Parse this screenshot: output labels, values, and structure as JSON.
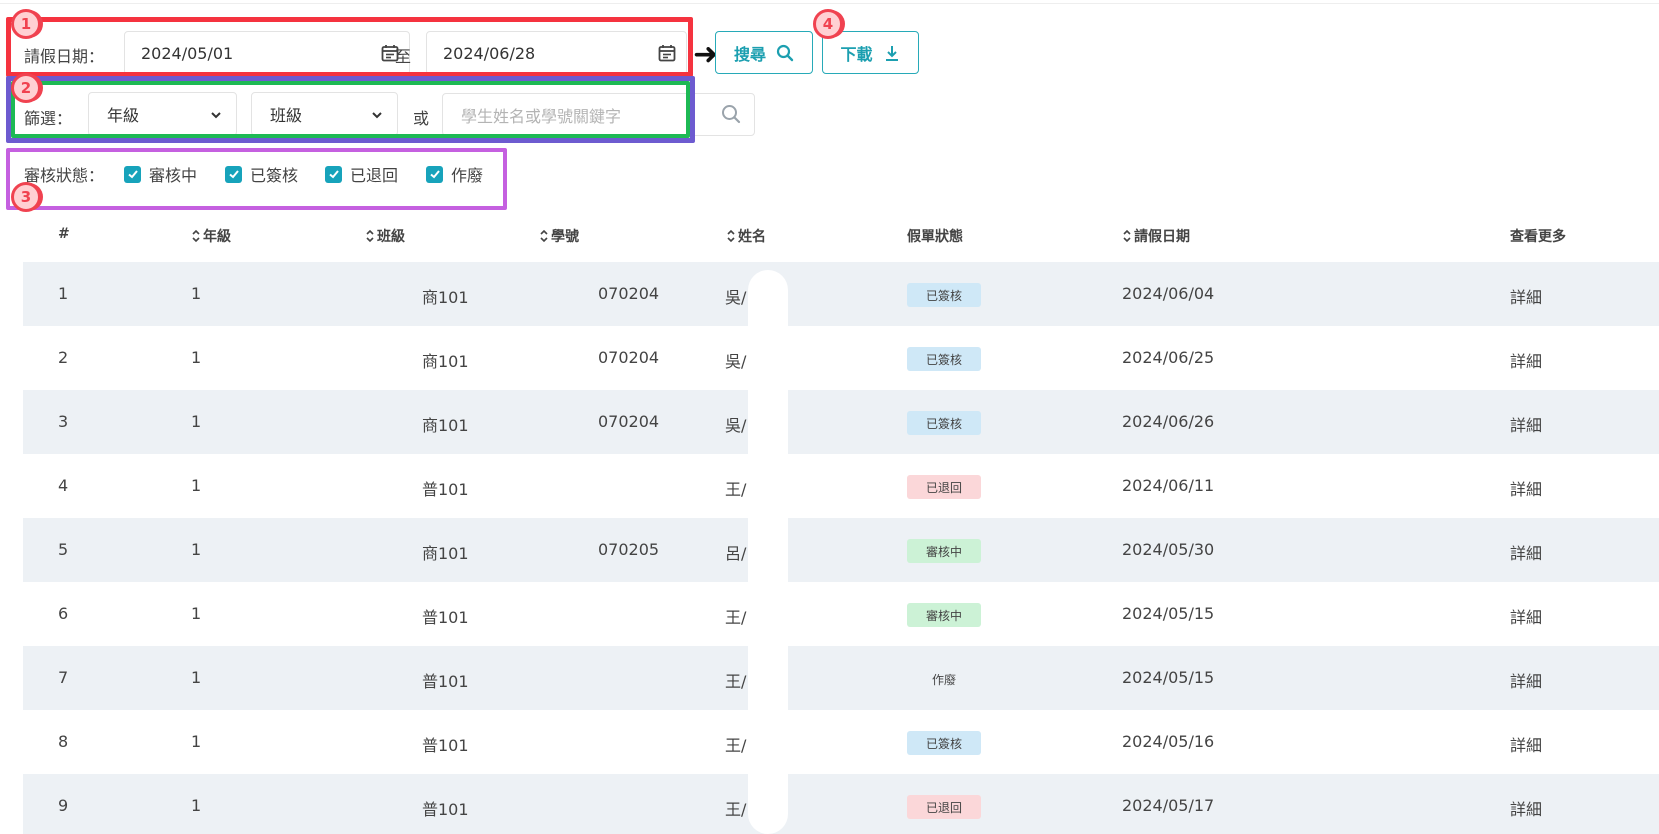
{
  "filters": {
    "date_label": "請假日期：",
    "date_from": "2024/05/01",
    "date_sep": "至",
    "date_to": "2024/06/28",
    "search_label": "搜尋",
    "download_label": "下載",
    "filter_label": "篩選：",
    "grade_select": "年級",
    "class_select": "班級",
    "or_label": "或",
    "keyword_placeholder": "學生姓名或學號關鍵字",
    "status_label": "審核狀態：",
    "status_options": [
      "審核中",
      "已簽核",
      "已退回",
      "作廢"
    ]
  },
  "annotations": [
    "1",
    "2",
    "3",
    "4"
  ],
  "table": {
    "headers": [
      "#",
      "年級",
      "班級",
      "學號",
      "姓名",
      "假單狀態",
      "請假日期",
      "查看更多"
    ],
    "rows": [
      {
        "no": "1",
        "grade": "1",
        "class": "商101",
        "id": "070204",
        "name": "吳/",
        "status": "已簽核",
        "date": "2024/06/04",
        "more": "詳細"
      },
      {
        "no": "2",
        "grade": "1",
        "class": "商101",
        "id": "070204",
        "name": "吳/",
        "status": "已簽核",
        "date": "2024/06/25",
        "more": "詳細"
      },
      {
        "no": "3",
        "grade": "1",
        "class": "商101",
        "id": "070204",
        "name": "吳/",
        "status": "已簽核",
        "date": "2024/06/26",
        "more": "詳細"
      },
      {
        "no": "4",
        "grade": "1",
        "class": "普101",
        "id": "",
        "name": "王/",
        "status": "已退回",
        "date": "2024/06/11",
        "more": "詳細"
      },
      {
        "no": "5",
        "grade": "1",
        "class": "商101",
        "id": "070205",
        "name": "呂/",
        "status": "審核中",
        "date": "2024/05/30",
        "more": "詳細"
      },
      {
        "no": "6",
        "grade": "1",
        "class": "普101",
        "id": "",
        "name": "王/",
        "status": "審核中",
        "date": "2024/05/15",
        "more": "詳細"
      },
      {
        "no": "7",
        "grade": "1",
        "class": "普101",
        "id": "",
        "name": "王/",
        "status": "作廢",
        "date": "2024/05/15",
        "more": "詳細"
      },
      {
        "no": "8",
        "grade": "1",
        "class": "普101",
        "id": "",
        "name": "王/",
        "status": "已簽核",
        "date": "2024/05/16",
        "more": "詳細"
      },
      {
        "no": "9",
        "grade": "1",
        "class": "普101",
        "id": "",
        "name": "王/",
        "status": "已退回",
        "date": "2024/05/17",
        "more": "詳細"
      }
    ]
  },
  "colors": {
    "accent": "#1c9fb0",
    "approved_bg": "#cfe8f7",
    "returned_bg": "#fbd7d9",
    "pending_bg": "#ccf2d6",
    "void_bg": "transparent",
    "annotation_red": "#f5333f"
  }
}
